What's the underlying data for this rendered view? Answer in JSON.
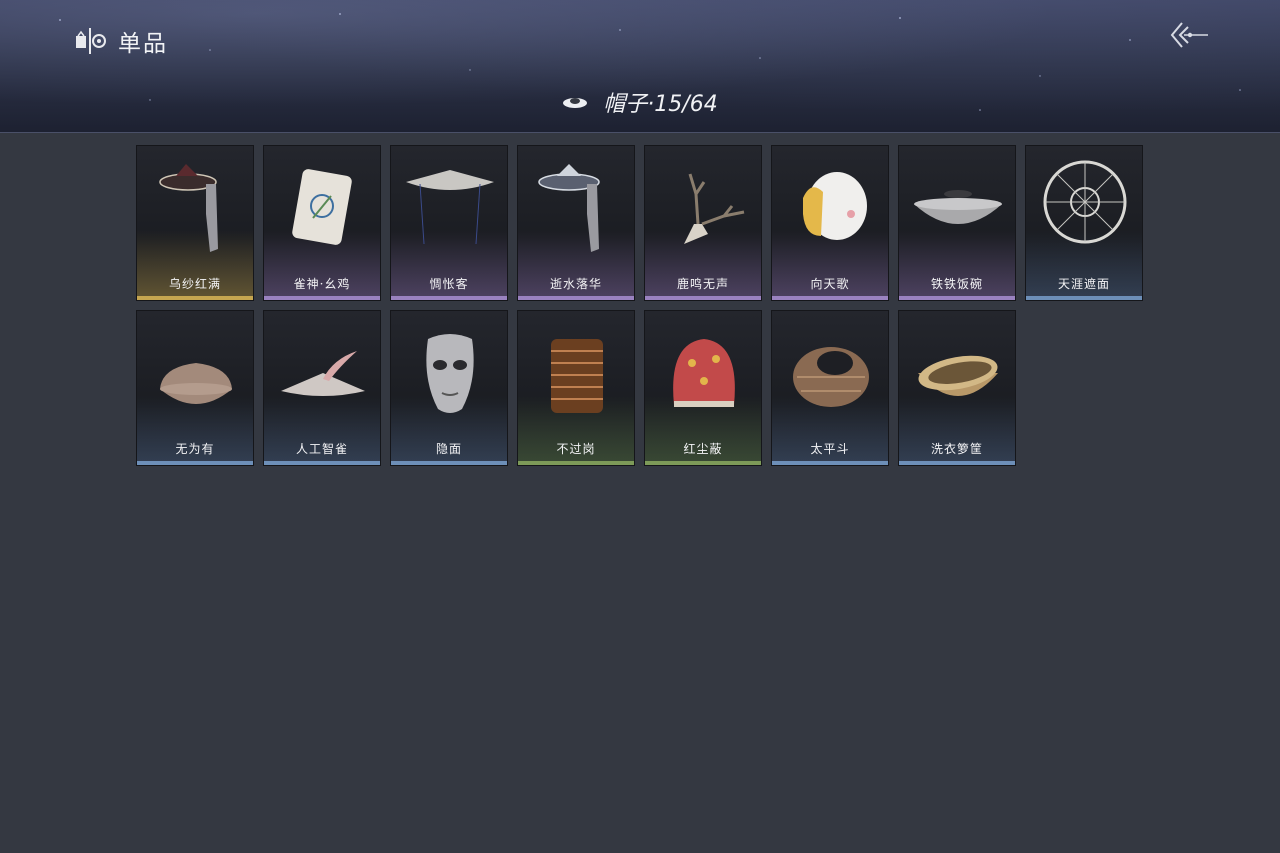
{
  "header": {
    "title": "单品",
    "title_icon": "outfit-icon",
    "back_icon": "back-arrow-icon"
  },
  "category": {
    "icon": "hat-icon",
    "label": "帽子·15/64"
  },
  "items": [
    {
      "name": "乌纱红满",
      "rarity": "gold"
    },
    {
      "name": "雀神·幺鸡",
      "rarity": "purple"
    },
    {
      "name": "惆怅客",
      "rarity": "purple"
    },
    {
      "name": "逝水落华",
      "rarity": "purple"
    },
    {
      "name": "鹿鸣无声",
      "rarity": "purple"
    },
    {
      "name": "向天歌",
      "rarity": "purple"
    },
    {
      "name": "铁铁饭碗",
      "rarity": "purple"
    },
    {
      "name": "天涯遮面",
      "rarity": "blue"
    },
    {
      "name": "无为有",
      "rarity": "blue"
    },
    {
      "name": "人工智雀",
      "rarity": "blue"
    },
    {
      "name": "隐面",
      "rarity": "blue"
    },
    {
      "name": "不过岗",
      "rarity": "green"
    },
    {
      "name": "红尘蔽",
      "rarity": "green"
    },
    {
      "name": "太平斗",
      "rarity": "blue"
    },
    {
      "name": "洗衣箩筐",
      "rarity": "blue"
    }
  ],
  "colors": {
    "background": "#343841",
    "gold": "#c6a650",
    "purple": "#9a82c0",
    "blue": "#6d8fb8",
    "green": "#7d9a58"
  }
}
